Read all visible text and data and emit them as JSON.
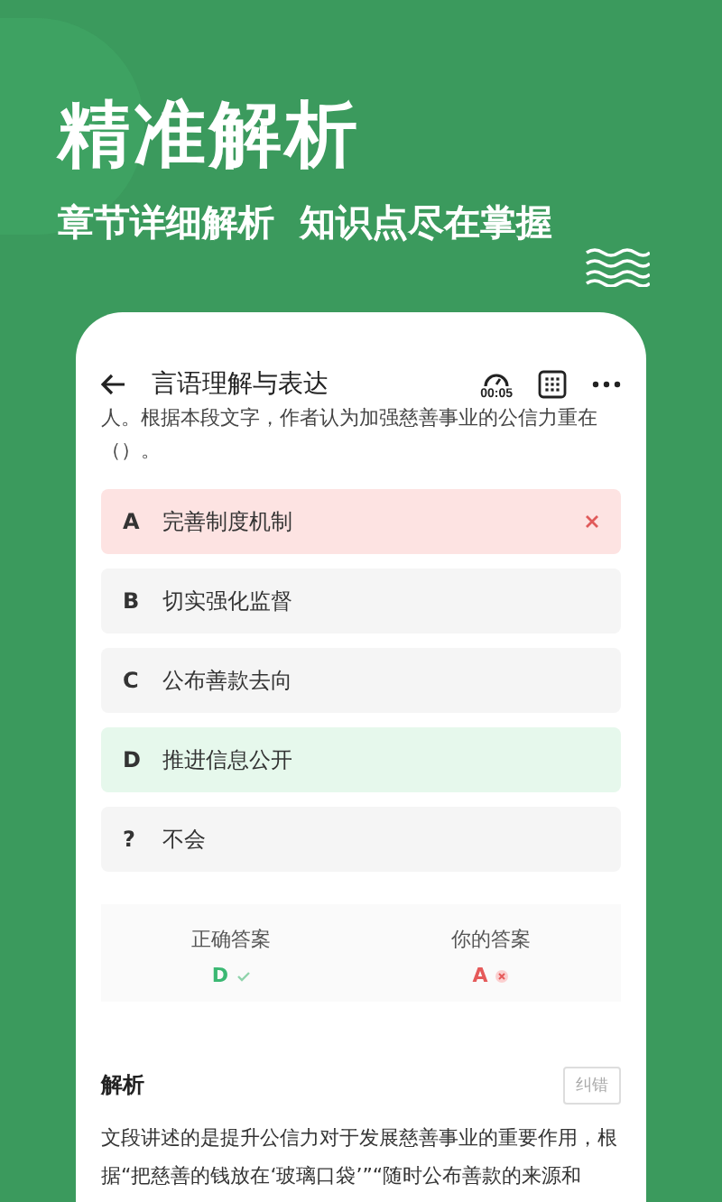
{
  "banner": {
    "title": "精准解析",
    "subtitle": "章节详细解析  知识点尽在掌握"
  },
  "header": {
    "title": "言语理解与表达",
    "timer": "00:05"
  },
  "question": {
    "text": "人。根据本段文字，作者认为加强慈善事业的公信力重在（）。"
  },
  "options": [
    {
      "letter": "A",
      "text": "完善制度机制",
      "selected": true,
      "correct": false
    },
    {
      "letter": "B",
      "text": "切实强化监督",
      "selected": false,
      "correct": false
    },
    {
      "letter": "C",
      "text": "公布善款去向",
      "selected": false,
      "correct": false
    },
    {
      "letter": "D",
      "text": "推进信息公开",
      "selected": false,
      "correct": true
    },
    {
      "letter": "?",
      "text": "不会",
      "selected": false,
      "correct": false
    }
  ],
  "answers": [
    {
      "label": "正确答案",
      "value": "D",
      "correct": true
    },
    {
      "label": "你的答案",
      "value": "A",
      "correct": false
    }
  ],
  "analysis": {
    "title": "解析",
    "report_button": "纠错",
    "text": "文段讲述的是提升公信力对于发展慈善事业的重要作用，根据“把慈善的钱放在‘玻璃口袋’”“随时公布善款的来源和"
  }
}
